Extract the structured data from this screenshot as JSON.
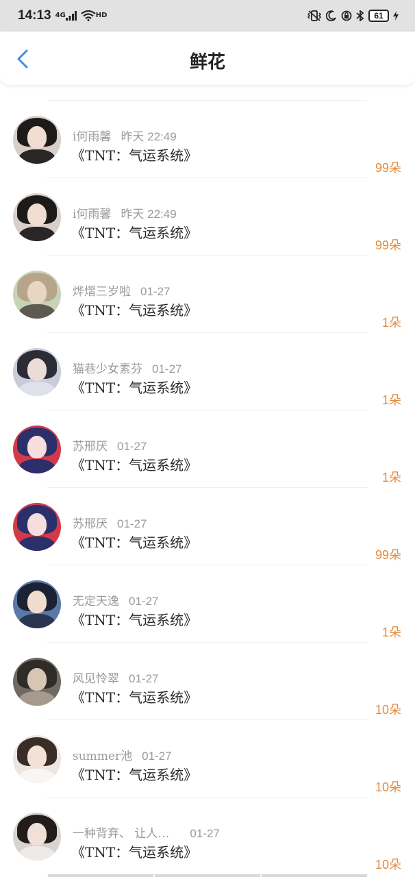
{
  "status_bar": {
    "time": "14:13",
    "network": "4G",
    "wifi": "HD",
    "battery": "61",
    "icons": [
      "signal-icon",
      "wifi-icon",
      "vibrate-icon",
      "moon-icon",
      "alarm-icon",
      "bluetooth-icon",
      "battery-icon",
      "charging-icon"
    ]
  },
  "header": {
    "title": "鲜花",
    "back_icon": "chevron-left-icon",
    "accent_color": "#3a8ee6"
  },
  "colors": {
    "count_color": "#e58a3c",
    "name_color": "#9a9a9a",
    "title_color": "#2b2b2b"
  },
  "items": [
    {
      "name": "i何雨馨",
      "date": "昨天 22:49",
      "book": "《TNT：气运系统》",
      "count": "99朵",
      "avatar": "avatar-girl-dark-hair"
    },
    {
      "name": "i何雨馨",
      "date": "昨天 22:49",
      "book": "《TNT：气运系统》",
      "count": "99朵",
      "avatar": "avatar-girl-dark-hair"
    },
    {
      "name": "烨熠三岁啦",
      "date": "01-27",
      "book": "《TNT：气运系统》",
      "count": "1朵",
      "avatar": "avatar-boy-light"
    },
    {
      "name": "猫巷少女素芬",
      "date": "01-27",
      "book": "《TNT：气运系统》",
      "count": "1朵",
      "avatar": "avatar-girl-lying"
    },
    {
      "name": "苏邢厌",
      "date": "01-27",
      "book": "《TNT：气运系统》",
      "count": "1朵",
      "avatar": "avatar-anime-girl"
    },
    {
      "name": "苏邢厌",
      "date": "01-27",
      "book": "《TNT：气运系统》",
      "count": "99朵",
      "avatar": "avatar-anime-girl"
    },
    {
      "name": "无定天逸",
      "date": "01-27",
      "book": "《TNT：气运系统》",
      "count": "1朵",
      "avatar": "avatar-anime-boy"
    },
    {
      "name": "风见怜翠",
      "date": "01-27",
      "book": "《TNT：气运系统》",
      "count": "10朵",
      "avatar": "avatar-girl-cat"
    },
    {
      "name": "summer池",
      "date": "01-27",
      "book": "《TNT：气运系统》",
      "count": "10朵",
      "avatar": "avatar-boy-white-shirt"
    },
    {
      "name": "一种背弃、 让人…",
      "date": "01-27",
      "book": "《TNT：气运系统》",
      "count": "10朵",
      "avatar": "avatar-girl-pose"
    }
  ]
}
